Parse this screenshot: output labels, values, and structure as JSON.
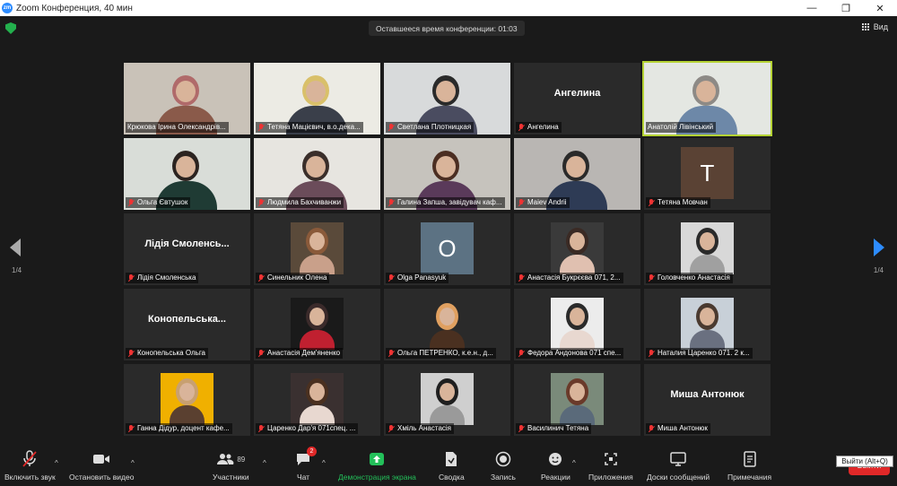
{
  "window": {
    "title": "Zoom Конференция, 40 мин",
    "app_icon": "zm"
  },
  "topbar": {
    "timer": "Оставшееся время конференции: 01:03",
    "view_label": "Вид"
  },
  "pager": {
    "left": "1/4",
    "right": "1/4"
  },
  "tiles": [
    {
      "name": "Крюкова Ірина Олександрів...",
      "muted": false,
      "kind": "video"
    },
    {
      "name": "Тетяна Мацієвич, в.о.дека...",
      "muted": true,
      "kind": "video"
    },
    {
      "name": "Светлана Плотницкая",
      "muted": true,
      "kind": "video"
    },
    {
      "name": "Ангелина",
      "muted": true,
      "kind": "name",
      "big": "Ангелина"
    },
    {
      "name": "Анатолій Лівінський",
      "muted": false,
      "kind": "video"
    },
    {
      "name": "Ольга Євтушок",
      "muted": true,
      "kind": "video"
    },
    {
      "name": "Людмила Бахчиванжи",
      "muted": true,
      "kind": "video"
    },
    {
      "name": "Галина Запша, завідувач каф...",
      "muted": true,
      "kind": "video"
    },
    {
      "name": "Maiev Andrii",
      "muted": true,
      "kind": "video"
    },
    {
      "name": "Тетяна Мовчан",
      "muted": true,
      "kind": "avatar",
      "big": "T"
    },
    {
      "name": "Лідія Смоленська",
      "muted": true,
      "kind": "name",
      "big": "Лідія  Смоленсь..."
    },
    {
      "name": "Синельник Олена",
      "muted": true,
      "kind": "photo"
    },
    {
      "name": "Olga Panasyuk",
      "muted": true,
      "kind": "avatar",
      "big": "O"
    },
    {
      "name": "Анастасія Букрєєва 071,  2...",
      "muted": true,
      "kind": "photo"
    },
    {
      "name": "Головченко Анастасія",
      "muted": true,
      "kind": "photo"
    },
    {
      "name": "Конопельська Ольга",
      "muted": true,
      "kind": "name",
      "big": "Конопельська..."
    },
    {
      "name": "Анастасія Дем'яненко",
      "muted": true,
      "kind": "photo"
    },
    {
      "name": "Ольга ПЕТРЕНКО, к.е.н., д...",
      "muted": true,
      "kind": "photo"
    },
    {
      "name": "Федора Андонова 071 спе...",
      "muted": true,
      "kind": "photo"
    },
    {
      "name": "Наталия Царенко 071. 2 к...",
      "muted": true,
      "kind": "photo"
    },
    {
      "name": "Ганна Дідур, доцент кафе...",
      "muted": true,
      "kind": "photo"
    },
    {
      "name": "Царенко Дар'я  071спец. ...",
      "muted": true,
      "kind": "photo"
    },
    {
      "name": "Хміль Анастасія",
      "muted": true,
      "kind": "photo"
    },
    {
      "name": "Василинич Тетяна",
      "muted": true,
      "kind": "photo"
    },
    {
      "name": "Миша Антонюк",
      "muted": true,
      "kind": "name",
      "big": "Миша  Антонюк"
    }
  ],
  "toolbar": {
    "audio": "Включить звук",
    "video": "Остановить видео",
    "participants": "Участники",
    "participants_count": "89",
    "chat": "Чат",
    "chat_badge": "2",
    "share": "Демонстрация экрана",
    "board": "Сводка",
    "record": "Запись",
    "reactions": "Реакции",
    "apps": "Приложения",
    "whiteboards": "Доски сообщений",
    "notes": "Примечания",
    "leave": "Выйти"
  },
  "tooltip": "Выйти (Alt+Q)",
  "colors": {
    "share_green": "#23c05a",
    "leave_red": "#e02828",
    "active_speaker": "#b5d334",
    "pager_blue": "#2d8cff"
  }
}
